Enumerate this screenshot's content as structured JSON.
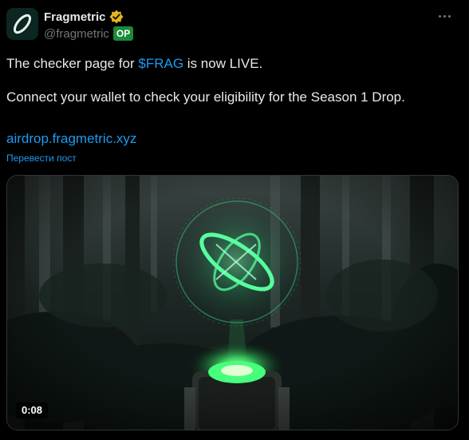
{
  "author": {
    "display_name": "Fragmetric",
    "handle": "@fragmetric",
    "badge": "OP",
    "verified_icon": "gold-checkmark-badge",
    "accent": "#e8b51e"
  },
  "tweet": {
    "line1_prefix": "The checker page for ",
    "cashtag": "$FRAG",
    "line1_suffix": " is now LIVE.",
    "line2": "Connect your wallet to check your eligibility for the Season 1 Drop.",
    "link": "airdrop.fragmetric.xyz",
    "translate_label": "Перевести пост"
  },
  "media": {
    "duration": "0:08",
    "accent": "#39ff9a"
  },
  "colors": {
    "link": "#1d9bf0",
    "text": "#e7e9ea",
    "muted": "#71767b",
    "op_badge": "#1b8a3a"
  }
}
